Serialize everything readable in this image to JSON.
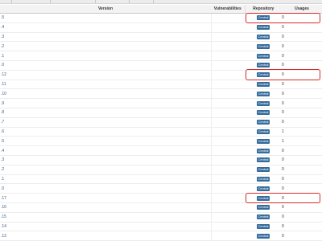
{
  "header": {
    "version": "Version",
    "vulnerabilities": "Vulnerabilities",
    "repository": "Repository",
    "usages": "Usages"
  },
  "rows": [
    {
      "version": ".5",
      "repository": "Central",
      "usages": "0"
    },
    {
      "version": ".4",
      "repository": "Central",
      "usages": "0"
    },
    {
      "version": ".3",
      "repository": "Central",
      "usages": "0"
    },
    {
      "version": ".2",
      "repository": "Central",
      "usages": "0"
    },
    {
      "version": ".1",
      "repository": "Central",
      "usages": "0"
    },
    {
      "version": ".0",
      "repository": "Central",
      "usages": "0"
    },
    {
      "version": ".12",
      "repository": "Central",
      "usages": "0"
    },
    {
      "version": ".11",
      "repository": "Central",
      "usages": "0"
    },
    {
      "version": ".10",
      "repository": "Central",
      "usages": "0"
    },
    {
      "version": ".9",
      "repository": "Central",
      "usages": "0"
    },
    {
      "version": ".8",
      "repository": "Central",
      "usages": "0"
    },
    {
      "version": ".7",
      "repository": "Central",
      "usages": "0"
    },
    {
      "version": ".6",
      "repository": "Central",
      "usages": "1"
    },
    {
      "version": ".5",
      "repository": "Central",
      "usages": "1"
    },
    {
      "version": ".4",
      "repository": "Central",
      "usages": "0"
    },
    {
      "version": ".3",
      "repository": "Central",
      "usages": "0"
    },
    {
      "version": ".2",
      "repository": "Central",
      "usages": "0"
    },
    {
      "version": ".1",
      "repository": "Central",
      "usages": "0"
    },
    {
      "version": ".0",
      "repository": "Central",
      "usages": "0"
    },
    {
      "version": ".17",
      "repository": "Central",
      "usages": "0"
    },
    {
      "version": ".16",
      "repository": "Central",
      "usages": "0"
    },
    {
      "version": ".15",
      "repository": "Central",
      "usages": "0"
    },
    {
      "version": ".14",
      "repository": "Central",
      "usages": "0"
    },
    {
      "version": ".13",
      "repository": "Central",
      "usages": "0"
    }
  ],
  "colors": {
    "badge": "#336b9b",
    "highlight": "#d72a2a",
    "version_link": "#2f5f8c"
  },
  "highlighted_rows": [
    0,
    6,
    19
  ]
}
